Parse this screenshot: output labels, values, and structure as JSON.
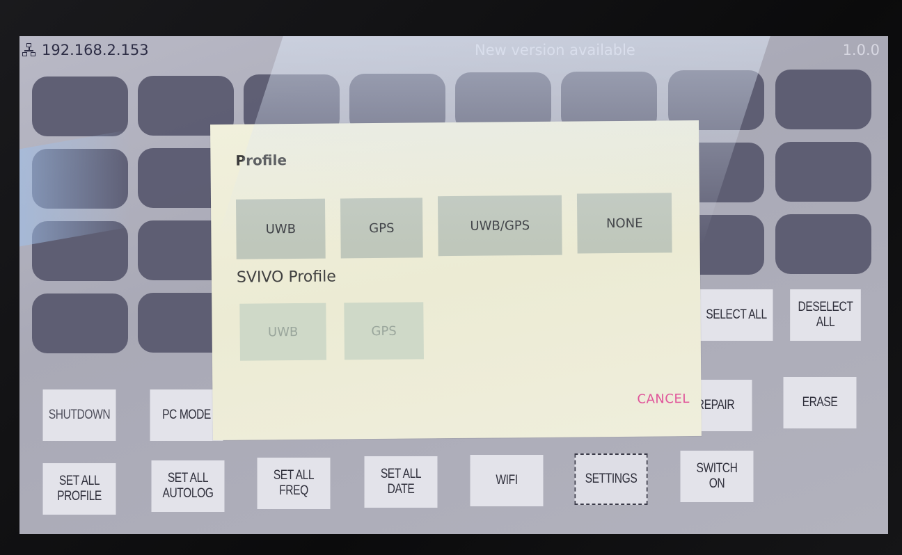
{
  "status_bar": {
    "ip_address": "192.168.2.153",
    "update_notice": "New version available",
    "version": "1.0.0"
  },
  "tag_grid": {
    "rows": 4,
    "columns": 8
  },
  "controls": {
    "select_all": "SELECT ALL",
    "deselect_all": "DESELECT ALL",
    "shutdown": "SHUTDOWN",
    "pc_mode": "PC MODE",
    "repair": "REPAIR",
    "erase": "ERASE",
    "set_all_profile": "SET ALL\nPROFILE",
    "set_all_autolog": "SET ALL\nAUTOLOG",
    "set_all_freq": "SET ALL\nFREQ",
    "set_all_date": "SET ALL\nDATE",
    "wifi": "WIFI",
    "settings": "SETTINGS",
    "switch_on": "SWITCH\nON"
  },
  "dialog": {
    "title": "Profile",
    "profile_options": [
      "UWB",
      "GPS",
      "UWB/GPS",
      "NONE"
    ],
    "svivo_title": "SVIVO Profile",
    "svivo_options": [
      "UWB",
      "GPS"
    ],
    "cancel_label": "CANCEL"
  },
  "icons": {
    "network": "network-icon"
  },
  "colors": {
    "cancel_accent": "#e0559a",
    "tile": "#55556b",
    "dialog_bg": "#efeedc"
  }
}
